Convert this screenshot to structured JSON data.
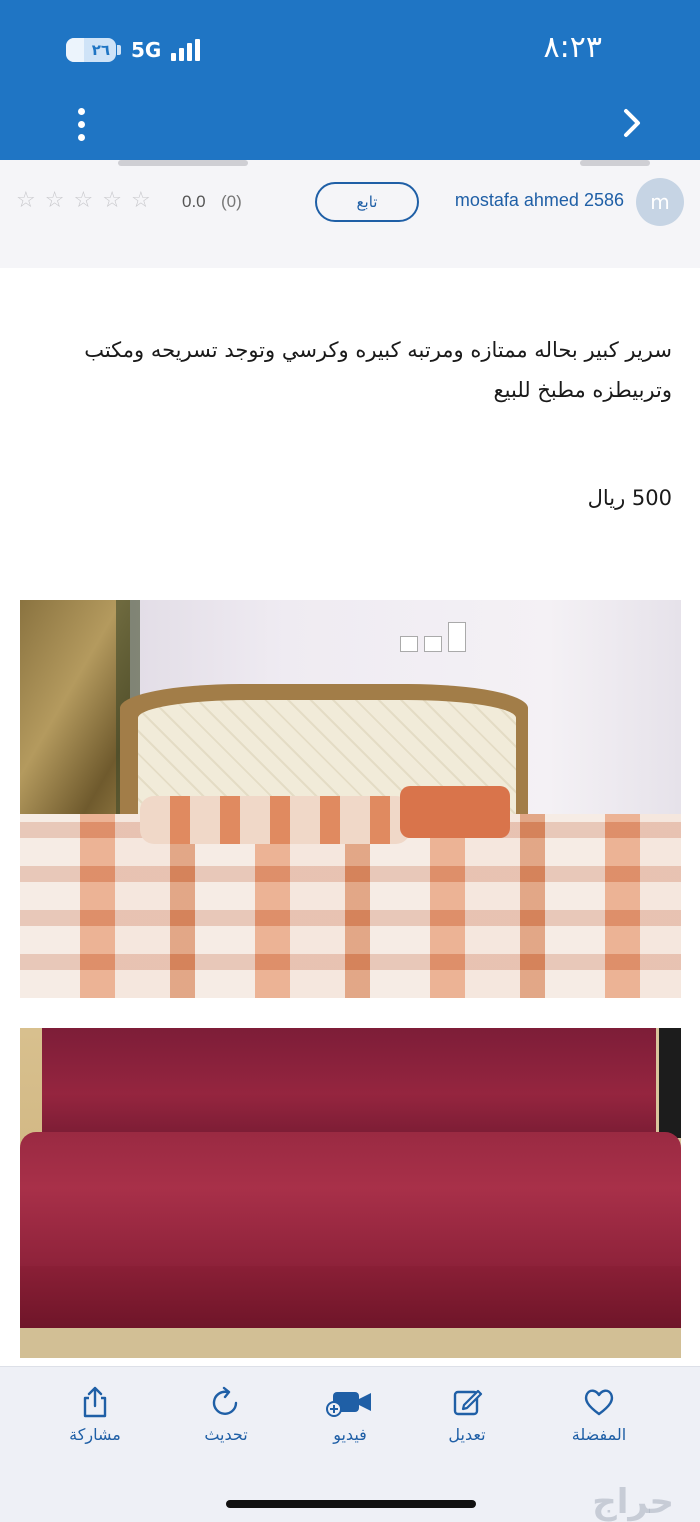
{
  "status_bar": {
    "time": "٨:٢٣",
    "battery": "٢٦",
    "network": "5G"
  },
  "seller": {
    "avatar_letter": "m",
    "name": "mostafa ahmed 2586",
    "follow_label": "تابع",
    "rating_value": "0.0",
    "rating_count": "(0)",
    "stars": 0
  },
  "listing": {
    "description": "سرير كبير بحاله ممتازه ومرتبه كبيره وكرسي وتوجد تسريحه ومكتب وتربيطزه مطبخ للبيع",
    "price": "500 ريال"
  },
  "bottom_nav": {
    "favorite": "المفضلة",
    "edit": "تعديل",
    "video": "فيديو",
    "refresh": "تحديث",
    "share": "مشاركة"
  },
  "watermark": "حراج",
  "colors": {
    "brand_blue": "#1f75c4",
    "link_blue": "#1f5fa6"
  }
}
